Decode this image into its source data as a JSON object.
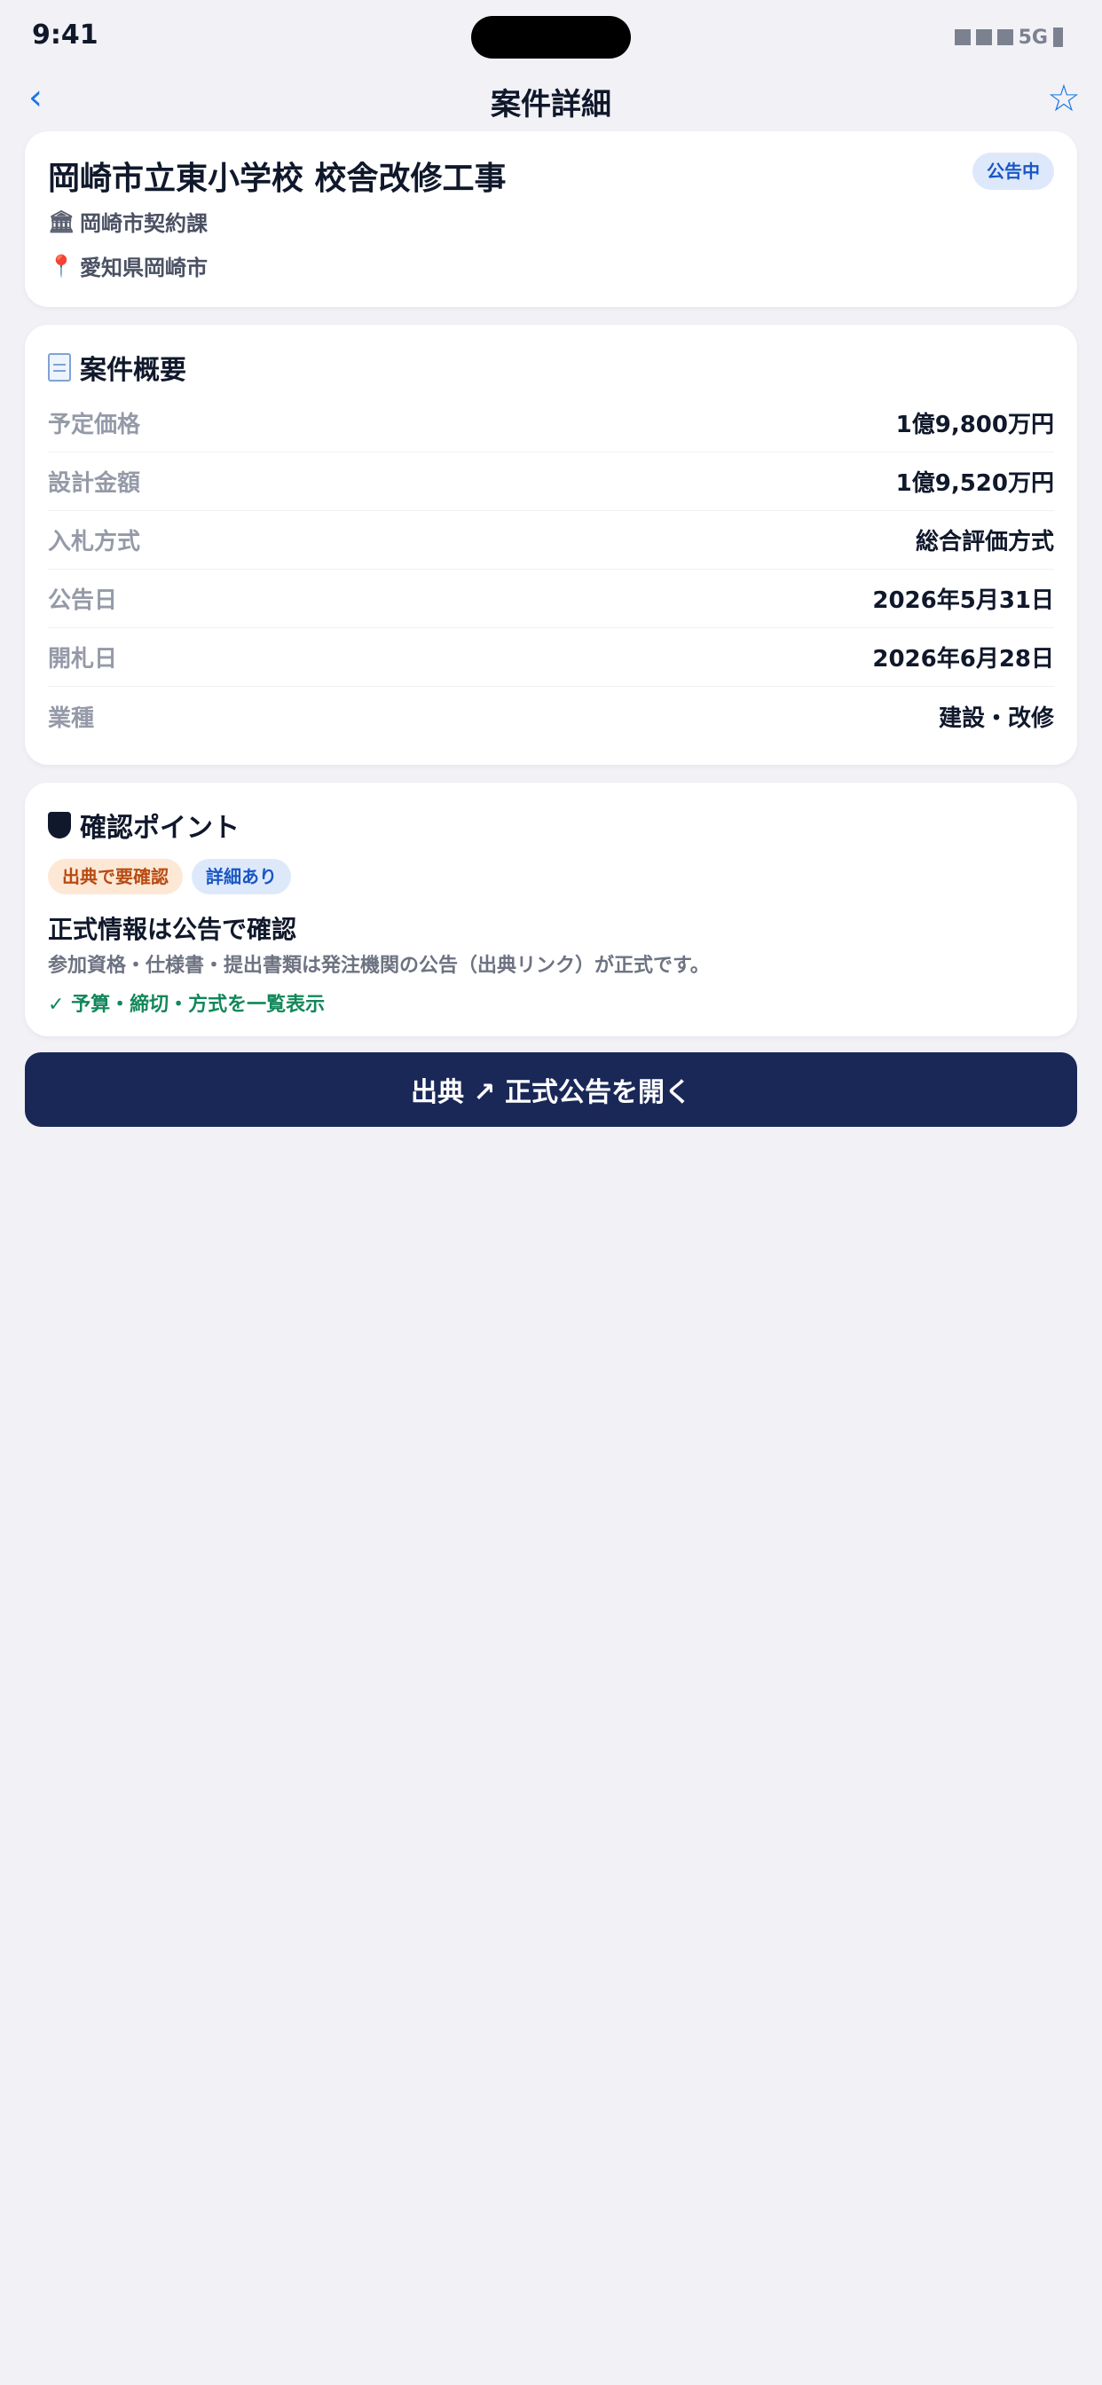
{
  "status_bar": {
    "time": "9:41",
    "network": "5G"
  },
  "nav": {
    "back_icon": "‹",
    "title": "案件詳細",
    "favorite_icon": "☆"
  },
  "project": {
    "name": "岡崎市立東小学校 校舎改修工事",
    "status": "公告中",
    "agency_icon": "🏛",
    "agency": "岡崎市契約課",
    "location_icon": "📍",
    "location": "愛知県岡崎市"
  },
  "overview": {
    "heading": "案件概要",
    "rows": [
      {
        "label": "予定価格",
        "value": "1億9,800万円"
      },
      {
        "label": "設計金額",
        "value": "1億9,520万円"
      },
      {
        "label": "入札方式",
        "value": "総合評価方式"
      },
      {
        "label": "公告日",
        "value": "2026年5月31日"
      },
      {
        "label": "開札日",
        "value": "2026年6月28日"
      },
      {
        "label": "業種",
        "value": "建設・改修"
      }
    ]
  },
  "check": {
    "heading": "確認ポイント",
    "tags": [
      "出典で要確認",
      "詳細あり"
    ],
    "title": "正式情報は公告で確認",
    "description": "参加資格・仕様書・提出書類は発注機関の公告（出典リンク）が正式です。",
    "confirmation": "✓ 予算・締切・方式を一覧表示"
  },
  "action": {
    "open_source_label": "出典 ↗ 正式公告を開く"
  },
  "colors": {
    "accent": "#1877e6",
    "button": "#1a2858",
    "background": "#f1f1f6",
    "success": "#12875a"
  }
}
